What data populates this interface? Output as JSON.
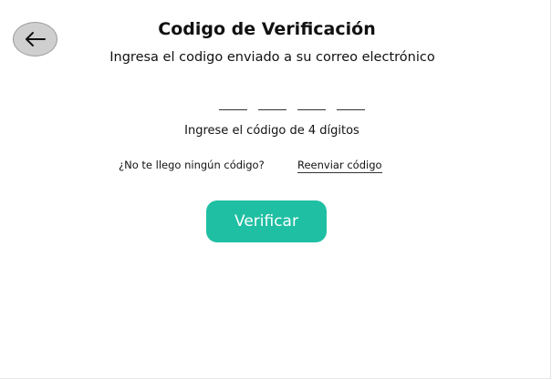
{
  "header": {
    "back_icon": "arrow-left-icon",
    "title": "Codigo de Verificación",
    "subtitle": "Ingresa el codigo enviado a su correo electrónico"
  },
  "code_input": {
    "digits": [
      "",
      "",
      "",
      ""
    ],
    "hint": "Ingrese el código de 4 dígitos"
  },
  "resend": {
    "question": "¿No te llego ningún código?",
    "link_label": "Reenviar código"
  },
  "actions": {
    "verify_label": "Verificar"
  },
  "colors": {
    "accent": "#1fbfa3",
    "back_button_bg": "#cfcfcf"
  }
}
